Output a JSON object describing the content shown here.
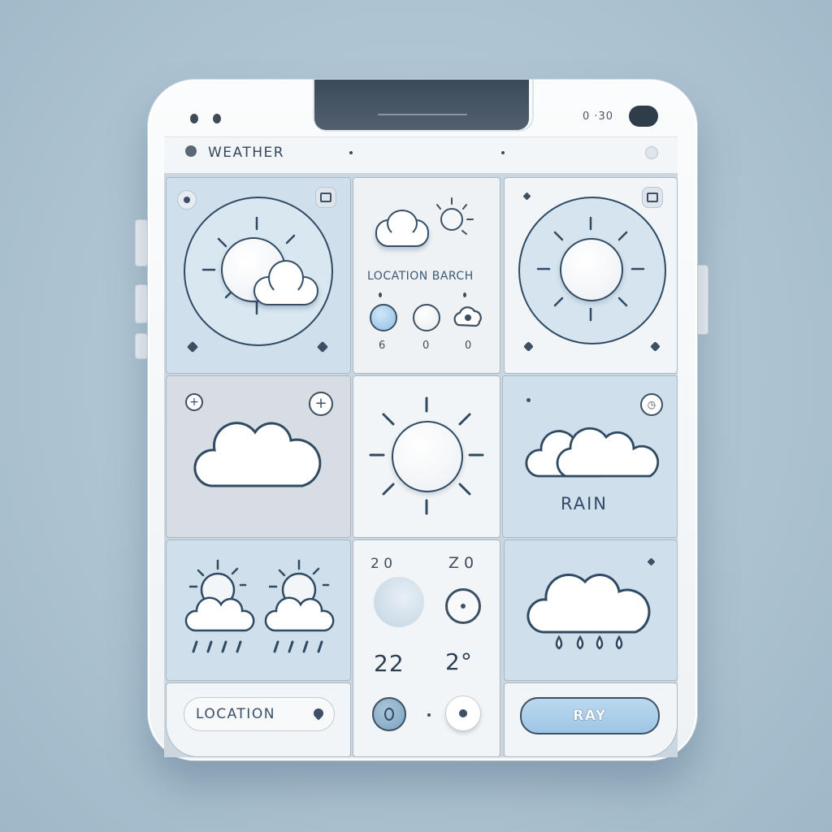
{
  "status": {
    "indicator": "0 ·30"
  },
  "titlebar": {
    "title": "WEATHER"
  },
  "location_search": {
    "label": "LOCATION BARCH",
    "values": [
      "6",
      "0",
      "0"
    ]
  },
  "rain_tile": {
    "label": "RAIN"
  },
  "temps": {
    "top_left": "2 0",
    "top_right": "Z 0",
    "bottom_left": "22",
    "bottom_right": "2°"
  },
  "buttons": {
    "location": "LOCATION",
    "ray": "RAY"
  },
  "colors": {
    "accent_blue": "#8fbfe6",
    "tile_blue": "#cfe0ec",
    "stroke": "#2f4a62"
  }
}
